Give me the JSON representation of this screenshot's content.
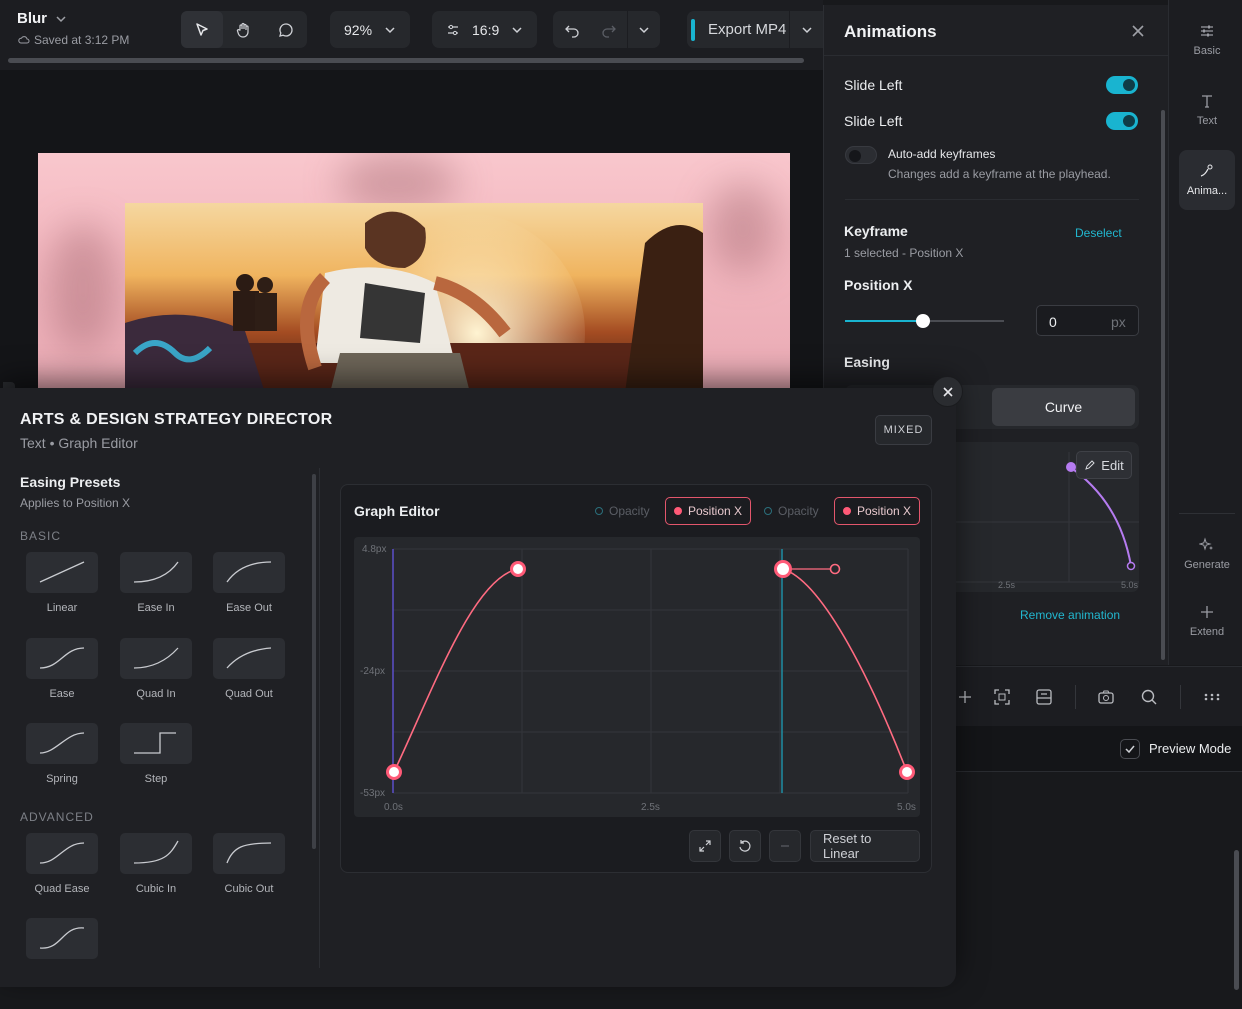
{
  "project": {
    "name": "Blur",
    "saved": "Saved at 3:12 PM"
  },
  "toolbar": {
    "zoom": "92%",
    "aspect": "16:9",
    "export_label": "Export MP4"
  },
  "animations_panel": {
    "title": "Animations",
    "rows": [
      {
        "label": "Slide Left",
        "enabled": true
      },
      {
        "label": "Slide Left",
        "enabled": true
      }
    ],
    "auto_add": {
      "title": "Auto-add keyframes",
      "desc": "Changes add a keyframe at the playhead.",
      "enabled": false
    },
    "keyframe": {
      "title": "Keyframe",
      "deselect": "Deselect",
      "selected": "1 selected - Position X"
    },
    "position_x": {
      "label": "Position X",
      "value": "0",
      "unit": "px",
      "slider_level": 0.5
    },
    "easing": {
      "label": "Easing",
      "active_mode": "Curve"
    },
    "mini_graph": {
      "edit_label": "Edit",
      "ticks": [
        "2.5s",
        "5.0s"
      ]
    },
    "remove_label": "Remove animation"
  },
  "rail": [
    {
      "label": "Basic",
      "icon": "sliders-icon"
    },
    {
      "label": "Text",
      "icon": "text-icon"
    },
    {
      "label": "Anima...",
      "icon": "animation-icon",
      "active": true
    },
    {
      "label": "Generate",
      "icon": "sparkle-icon"
    },
    {
      "label": "Extend",
      "icon": "plus-icon"
    }
  ],
  "preview": {
    "label": "Preview Mode",
    "checked": true
  },
  "modal": {
    "title": "ARTS & DESIGN STRATEGY DIRECTOR",
    "subtitle": "Text • Graph Editor",
    "badge": "MIXED",
    "presets": {
      "title": "Easing Presets",
      "subtitle": "Applies to Position X",
      "basic_label": "BASIC",
      "advanced_label": "ADVANCED",
      "basic": [
        "Linear",
        "Ease In",
        "Ease Out",
        "Ease",
        "Quad In",
        "Quad Out",
        "Spring",
        "Step"
      ],
      "advanced": [
        "Quad Ease",
        "Cubic In",
        "Cubic Out"
      ]
    },
    "graph": {
      "title": "Graph Editor",
      "chips": [
        "Opacity",
        "Position X",
        "Opacity",
        "Position X"
      ],
      "y_labels": [
        "4.8px",
        "-24px",
        "-53px"
      ],
      "x_labels": [
        "0.0s",
        "2.5s",
        "5.0s"
      ],
      "reset_label": "Reset to Linear"
    }
  },
  "colors": {
    "accent": "#19b4d0",
    "curve": "#ff6b81",
    "key": "#ff5a77",
    "purple": "#b57bf0"
  }
}
